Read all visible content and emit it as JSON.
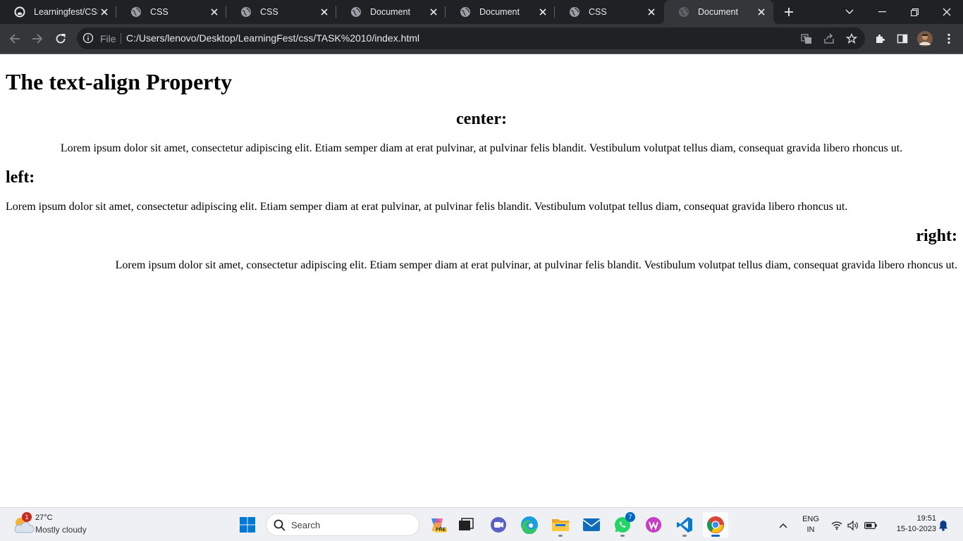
{
  "browser": {
    "tabs": [
      {
        "title": "Learningfest/CSS",
        "favicon": "github-icon"
      },
      {
        "title": "CSS",
        "favicon": "globe-icon"
      },
      {
        "title": "CSS",
        "favicon": "globe-icon"
      },
      {
        "title": "Document",
        "favicon": "globe-icon"
      },
      {
        "title": "Document",
        "favicon": "globe-icon"
      },
      {
        "title": "CSS",
        "favicon": "globe-icon"
      },
      {
        "title": "Document",
        "favicon": "globe-icon",
        "active": true
      }
    ],
    "address": {
      "scheme_label": "File",
      "url": "C:/Users/lenovo/Desktop/LearningFest/css/TASK%2010/index.html"
    },
    "colors": {
      "tabstrip": "#202124",
      "toolbar": "#35363a",
      "omnibox": "#202124"
    }
  },
  "page": {
    "title": "The text-align Property",
    "sections": [
      {
        "heading": "center:",
        "text": "Lorem ipsum dolor sit amet, consectetur adipiscing elit. Etiam semper diam at erat pulvinar, at pulvinar felis blandit. Vestibulum volutpat tellus diam, consequat gravida libero rhoncus ut."
      },
      {
        "heading": "left:",
        "text": "Lorem ipsum dolor sit amet, consectetur adipiscing elit. Etiam semper diam at erat pulvinar, at pulvinar felis blandit. Vestibulum volutpat tellus diam, consequat gravida libero rhoncus ut."
      },
      {
        "heading": "right:",
        "text": "Lorem ipsum dolor sit amet, consectetur adipiscing elit. Etiam semper diam at erat pulvinar, at pulvinar felis blandit. Vestibulum volutpat tellus diam, consequat gravida libero rhoncus ut."
      }
    ]
  },
  "taskbar": {
    "weather": {
      "temp": "27°C",
      "desc": "Mostly cloudy",
      "badge": "1"
    },
    "search_label": "Search",
    "whatsapp_badge": "7",
    "copilot_tag": "PRE",
    "language": {
      "line1": "ENG",
      "line2": "IN"
    },
    "clock": {
      "time": "19:51",
      "date": "15-10-2023"
    }
  }
}
